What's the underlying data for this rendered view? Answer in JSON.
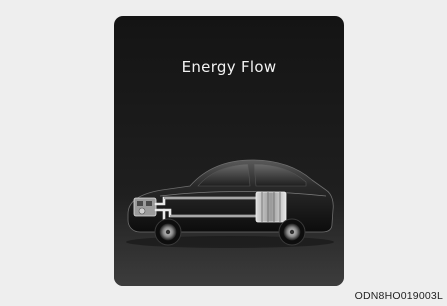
{
  "display": {
    "title": "Energy Flow"
  },
  "graphic": {
    "icon": "hybrid-car-energy-flow-icon"
  },
  "figure_code": "ODN8HO019003L"
}
